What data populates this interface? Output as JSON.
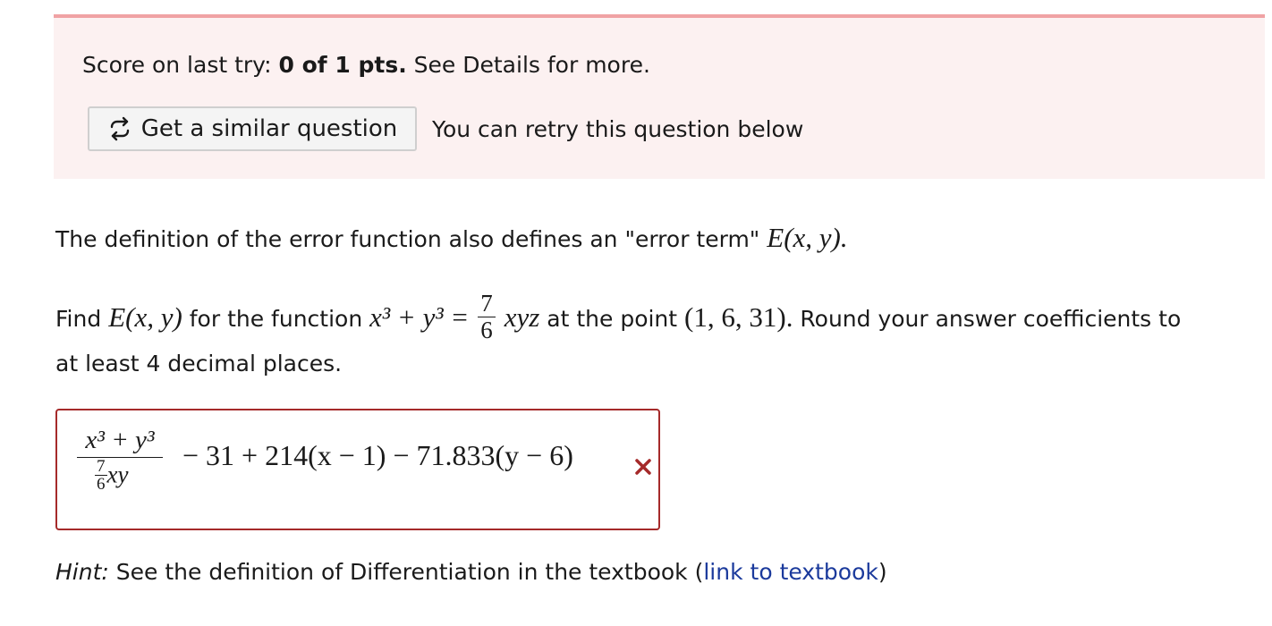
{
  "score": {
    "prefix": "Score on last try:",
    "value": "0 of 1 pts.",
    "suffix": "See Details for more."
  },
  "similar_button": {
    "icon": "refresh-icon",
    "label": "Get a similar question"
  },
  "retry_text": "You can retry this question below",
  "question": {
    "para1_text": "The definition of the error function also defines an \"error term\"",
    "para1_math": "E(x, y).",
    "find_word": "Find",
    "find_math": "E(x, y)",
    "for_text": "for the function",
    "func_lhs": "x³ + y³ =",
    "coef_num": "7",
    "coef_den": "6",
    "func_rhs": "xyz",
    "at_text": "at the point",
    "point": "(1, 6, 31).",
    "round_text": "Round your answer coefficients to",
    "line2_text": "at least 4 decimal places."
  },
  "answer": {
    "numerator": "x³ + y³",
    "denominator_coef_num": "7",
    "denominator_coef_den": "6",
    "denominator_vars": "xy",
    "rest": "− 31 + 214(x − 1) − 71.833(y − 6)",
    "status": "incorrect",
    "status_icon": "x-mark-icon",
    "status_color": "#a52a2a"
  },
  "hint": {
    "label": "Hint:",
    "text": "See the definition of Differentiation in the textbook (",
    "link": "link to textbook",
    "close": ")"
  },
  "colors": {
    "panel_bg": "#fcf1f1",
    "panel_border": "#f0a2a4",
    "link": "#1b3a9c"
  }
}
